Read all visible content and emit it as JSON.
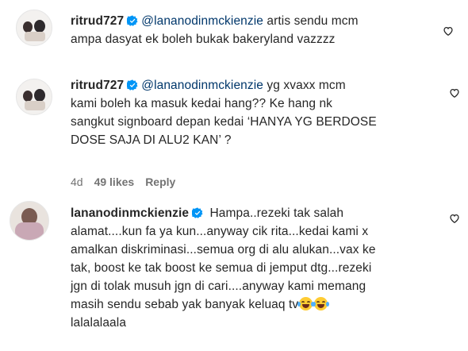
{
  "comments": [
    {
      "username": "ritrud727",
      "mention": "@lananodinmckienzie",
      "text": " artis sendu mcm\nampa dasyat ek boleh bukak bakeryland vazzzz"
    },
    {
      "username": "ritrud727",
      "mention": "@lananodinmckienzie",
      "text": " yg xvaxx mcm\nkami boleh ka masuk kedai hang?? Ke hang nk\nsangkut signboard depan kedai ‘HANYA YG BERDOSE\nDOSE SAJA DI ALU2 KAN’ ?",
      "time": "4d",
      "likes": "49 likes",
      "reply": "Reply"
    },
    {
      "username": "lananodinmckienzie",
      "text": " Hampa..rezeki tak salah\nalamat....kun fa ya kun...anyway cik rita...kedai kami x\namalkan diskriminasi...semua org di alu alukan...vax ke\ntak, boost ke tak boost ke semua di jemput dtg...rezeki\njgn di tolak musuh jgn di cari....anyway kami memang\nmasih sendu sebab yak banyak keluaq tv",
      "text_end": "\nlalalalaala"
    }
  ],
  "icons": {
    "verified": "verified-badge-icon",
    "heart": "heart-outline-icon",
    "emoji": "face-with-tears-of-joy-emoji"
  },
  "colors": {
    "mention": "#00376b",
    "verified": "#0095f6",
    "meta": "#737373"
  }
}
